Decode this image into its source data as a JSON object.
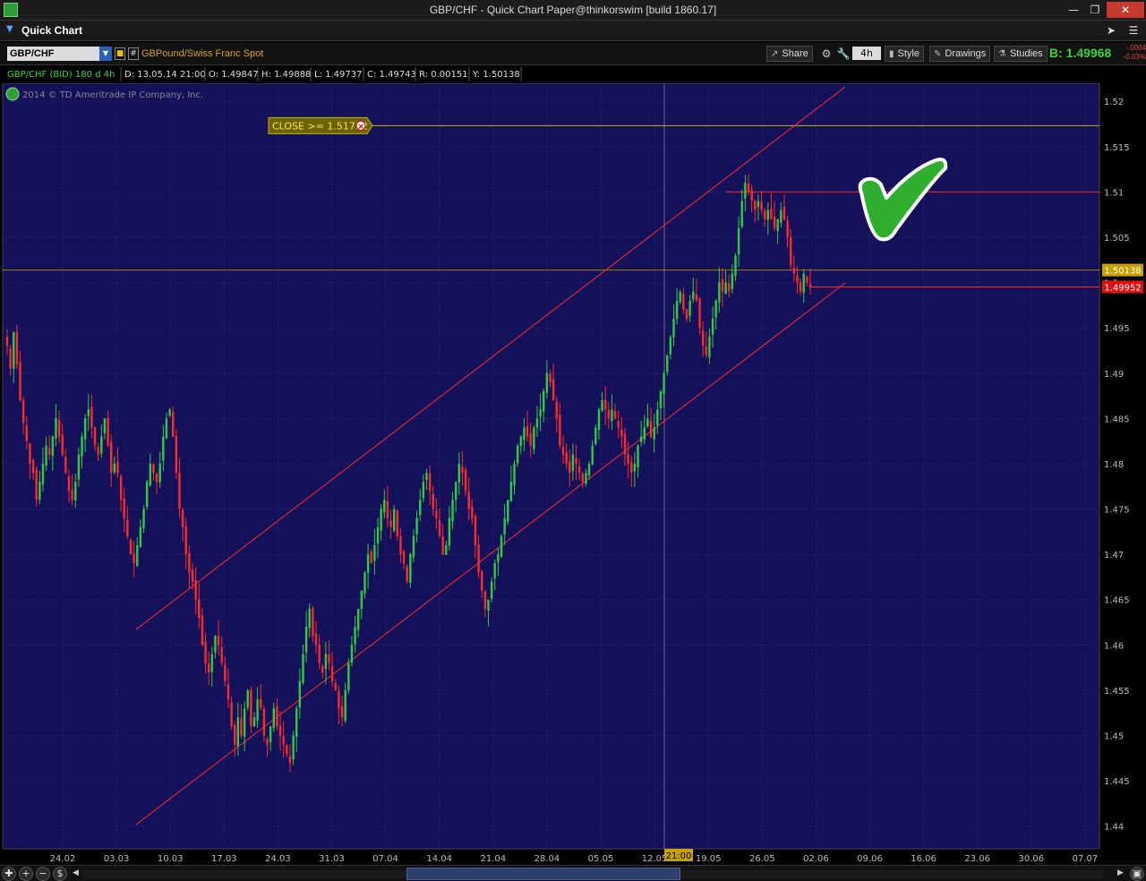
{
  "window": {
    "title": "GBP/CHF - Quick Chart Paper@thinkorswim [build 1860.17]",
    "min": "—",
    "max": "❐",
    "close": "✕"
  },
  "header": {
    "title": "Quick Chart"
  },
  "toolbar": {
    "symbol": "GBP/CHF",
    "description": "GBPound/Swiss Franc Spot",
    "share": "Share",
    "aggregation": "4h",
    "style": "Style",
    "drawings": "Drawings",
    "studies": "Studies",
    "bid": "B: 1.49968",
    "change_abs": "-.0004",
    "change_pct": "-0.03%"
  },
  "info_bar": {
    "symbol": "GBP/CHF (BID) 180 d 4h",
    "date": "D: 13.05.14 21:00",
    "open": "O: 1.49847",
    "high": "H: 1.49888",
    "low": "L: 1.49737",
    "close": "C: 1.49743",
    "range": "R: 0.00151",
    "y": "Y: 1.50138"
  },
  "copyright": "2014 © TD Ameritrade IP Company, Inc.",
  "alert_label": "CLOSE >= 1.51732",
  "colors": {
    "background": "#14115a",
    "up": "#2ecc40",
    "down": "#ff2a2a",
    "channel": "#ff2a2a",
    "grid": "#2a2a7a",
    "alert": "#c8b400"
  },
  "chart_data": {
    "type": "candlestick",
    "y_ticks": [
      "1.52",
      "1.515",
      "1.51",
      "1.505",
      "1.5",
      "1.495",
      "1.49",
      "1.485",
      "1.48",
      "1.475",
      "1.47",
      "1.465",
      "1.46",
      "1.455",
      "1.45",
      "1.445",
      "1.44"
    ],
    "x_ticks": [
      "24.02",
      "03.03",
      "10.03",
      "17.03",
      "24.03",
      "31.03",
      "07.04",
      "14.04",
      "21.04",
      "28.04",
      "05.05",
      "12.05",
      "19.05",
      "26.05",
      "02.06",
      "09.06",
      "16.06",
      "23.06",
      "30.06",
      "07.07"
    ],
    "ylim": [
      1.4375,
      1.522
    ],
    "cursor_time_label": "21:00",
    "price_labels": [
      {
        "value": 1.50138,
        "text": "1.50138",
        "color": "#c8a000"
      },
      {
        "value": 1.49952,
        "text": "1.49952",
        "color": "#e01010"
      }
    ],
    "alert_level": 1.51732,
    "resistance_level": 1.51,
    "support_level": 1.49952,
    "channel": {
      "upper": [
        [
          1.4607,
          1.52127
        ]
      ],
      "lower": [
        [
          1.4391,
          1.4995
        ]
      ]
    },
    "path": [
      [
        1.493,
        1.4905,
        1.4945,
        1.491,
        1.487,
        1.4845,
        1.4825,
        1.48,
        1.479,
        1.476,
        1.478,
        1.48,
        1.482,
        1.481,
        1.483,
        1.485,
        1.483,
        1.481,
        1.479,
        1.477,
        1.476,
        1.478,
        1.481,
        1.483,
        1.485,
        1.486,
        1.484,
        1.482,
        1.481,
        1.483,
        1.485,
        1.482,
        1.479,
        1.48,
        1.479,
        1.476,
        1.474,
        1.472,
        1.47,
        1.469,
        1.471,
        1.473,
        1.475,
        1.478,
        1.48,
        1.479,
        1.478,
        1.48,
        1.483,
        1.485,
        1.486,
        1.483,
        1.479,
        1.475,
        1.473,
        1.47,
        1.468,
        1.467,
        1.465,
        1.463,
        1.46,
        1.458,
        1.457,
        1.459,
        1.461,
        1.46,
        1.458,
        1.456,
        1.454,
        1.451,
        1.449,
        1.452,
        1.45,
        1.453,
        1.455,
        1.451,
        1.452,
        1.454,
        1.453,
        1.45,
        1.449,
        1.451,
        1.453,
        1.451,
        1.45,
        1.449,
        1.448,
        1.447,
        1.45,
        1.453,
        1.456,
        1.459,
        1.462,
        1.464,
        1.461,
        1.46,
        1.458,
        1.457,
        1.459,
        1.458,
        1.456,
        1.455,
        1.453,
        1.452,
        1.455,
        1.458,
        1.46,
        1.462,
        1.464,
        1.466,
        1.468,
        1.47,
        1.469,
        1.471,
        1.473,
        1.475,
        1.476,
        1.474,
        1.473,
        1.475,
        1.472,
        1.47,
        1.469,
        1.467,
        1.47,
        1.472,
        1.474,
        1.476,
        1.478,
        1.479,
        1.477,
        1.475,
        1.474,
        1.472,
        1.47,
        1.471,
        1.474,
        1.476,
        1.478,
        1.48,
        1.479,
        1.477,
        1.475,
        1.474,
        1.471,
        1.468,
        1.466,
        1.464,
        1.465,
        1.467,
        1.469,
        1.47,
        1.472,
        1.474,
        1.476,
        1.478,
        1.48,
        1.482,
        1.483,
        1.484,
        1.483,
        1.482,
        1.484,
        1.485,
        1.486,
        1.488,
        1.49,
        1.489,
        1.487,
        1.485,
        1.482,
        1.481,
        1.48,
        1.479,
        1.481,
        1.48,
        1.479,
        1.478,
        1.479,
        1.48,
        1.482,
        1.484,
        1.486,
        1.487,
        1.486,
        1.485,
        1.486,
        1.485,
        1.484,
        1.483,
        1.481,
        1.48,
        1.479,
        1.48,
        1.482,
        1.483,
        1.484,
        1.485,
        1.483,
        1.484,
        1.486,
        1.488,
        1.49,
        1.492,
        1.494,
        1.496,
        1.498,
        1.499,
        1.497,
        1.496,
        1.498,
        1.499,
        1.498,
        1.495,
        1.493,
        1.492,
        1.494,
        1.496,
        1.498,
        1.5,
        1.499,
        1.5,
        1.499,
        1.501,
        1.503,
        1.506,
        1.509,
        1.511,
        1.51,
        1.509,
        1.508,
        1.509,
        1.508,
        1.507,
        1.508,
        1.507,
        1.506,
        1.507,
        1.508,
        1.507,
        1.505,
        1.502,
        1.501,
        1.5,
        1.499,
        1.501,
        1.5,
        1.4995
      ]
    ]
  }
}
